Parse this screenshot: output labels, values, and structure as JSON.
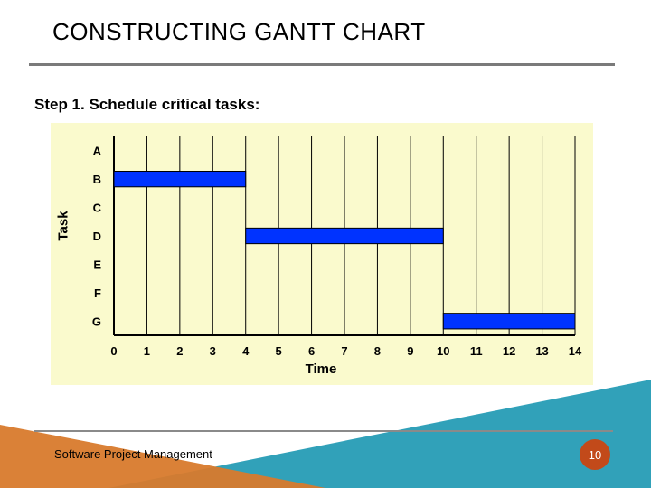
{
  "title": "CONSTRUCTING GANTT CHART",
  "step_text": "Step 1. Schedule critical tasks:",
  "footer": "Software Project Management",
  "page_number": "10",
  "chart_data": {
    "type": "gantt",
    "xlabel": "Time",
    "ylabel": "Task",
    "x_ticks": [
      0,
      1,
      2,
      3,
      4,
      5,
      6,
      7,
      8,
      9,
      10,
      11,
      12,
      13,
      14
    ],
    "xlim": [
      0,
      14
    ],
    "tasks": [
      "A",
      "B",
      "C",
      "D",
      "E",
      "F",
      "G"
    ],
    "bars": [
      {
        "task": "B",
        "start": 0,
        "end": 4
      },
      {
        "task": "D",
        "start": 4,
        "end": 10
      },
      {
        "task": "G",
        "start": 10,
        "end": 14
      }
    ],
    "bar_color": "#0033ff",
    "grid": true
  }
}
